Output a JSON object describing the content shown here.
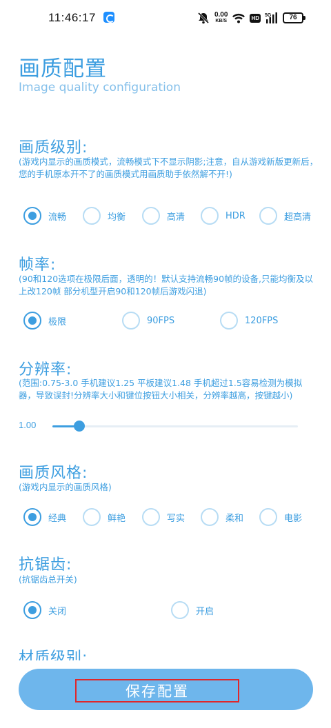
{
  "status_bar": {
    "time": "11:46:17",
    "net_speed_value": "0.00",
    "net_speed_unit": "KB/S",
    "hd_badge": "HD",
    "signal_label": "5G",
    "battery": "76"
  },
  "page": {
    "title": "画质配置",
    "subtitle": "Image quality configuration"
  },
  "sections": {
    "quality_level": {
      "title": "画质级别:",
      "description": "(游戏内显示的画质模式，流畅模式下不显示阴影;注意，自从游戏新版更新后，您的手机原本开不了的画质模式用画质助手依然解不开!)",
      "options": [
        "流畅",
        "均衡",
        "高清",
        "HDR",
        "超高清"
      ],
      "selected": "流畅"
    },
    "frame_rate": {
      "title": "帧率:",
      "description": "(90和120选项在极限后面，透明的！默认支持流畅90帧的设备,只能均衡及以上改120帧  部分机型开启90和120帧后游戏闪退)",
      "options": [
        "极限",
        "90FPS",
        "120FPS"
      ],
      "selected": "极限"
    },
    "resolution": {
      "title": "分辨率:",
      "description": "(范围:0.75-3.0  手机建议1.25 平板建议1.48  手机超过1.5容易检测为模拟器，导致误封!分辨率大小和键位按钮大小相关，分辨率越高，按键越小)",
      "value": "1.00",
      "fraction": 0.11
    },
    "style": {
      "title": "画质风格:",
      "description": "(游戏内显示的画质风格)",
      "options": [
        "经典",
        "鲜艳",
        "写实",
        "柔和",
        "电影"
      ],
      "selected": "经典"
    },
    "anti_aliasing": {
      "title": "抗锯齿:",
      "description": "(抗锯齿总开关)",
      "options": [
        "关闭",
        "开启"
      ],
      "selected": "关闭"
    },
    "material_level": {
      "title": "材质级别:"
    }
  },
  "save_button": {
    "label": "保存配置"
  },
  "colors": {
    "accent": "#3d9ee0",
    "button": "#6eb6ec",
    "highlight_box": "#e0262a"
  }
}
